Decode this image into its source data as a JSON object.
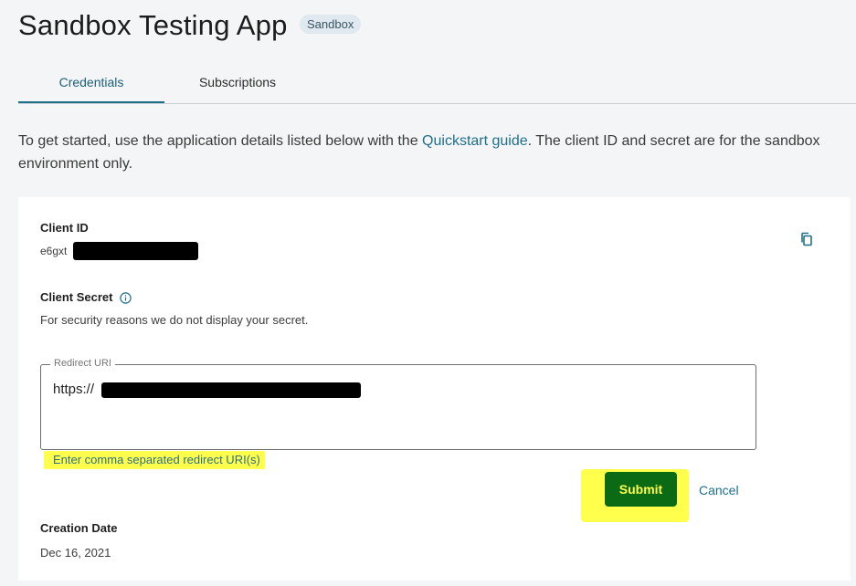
{
  "app": {
    "title": "Sandbox Testing App",
    "badge": "Sandbox"
  },
  "tabs": [
    {
      "label": "Credentials",
      "active": true
    },
    {
      "label": "Subscriptions",
      "active": false
    }
  ],
  "intro": {
    "before": "To get started, use the application details listed below with the ",
    "link": "Quickstart guide",
    "after": ". The client ID and secret are for the sandbox environment only."
  },
  "card": {
    "client_id_label": "Client ID",
    "client_id_value": "e6gxt",
    "client_secret_label": "Client Secret",
    "client_secret_note": "For security reasons we do not display your secret.",
    "redirect_label": "Redirect URI",
    "redirect_value": "https://",
    "redirect_hint": "Enter comma separated redirect URI(s)",
    "submit_label": "Submit",
    "cancel_label": "Cancel",
    "creation_label": "Creation Date",
    "creation_value": "Dec 16, 2021"
  },
  "colors": {
    "accent": "#1f6f8b",
    "submit_bg": "#0a6b14",
    "highlight": "#ffff4c"
  },
  "icons": [
    "copy-icon",
    "info-icon"
  ]
}
